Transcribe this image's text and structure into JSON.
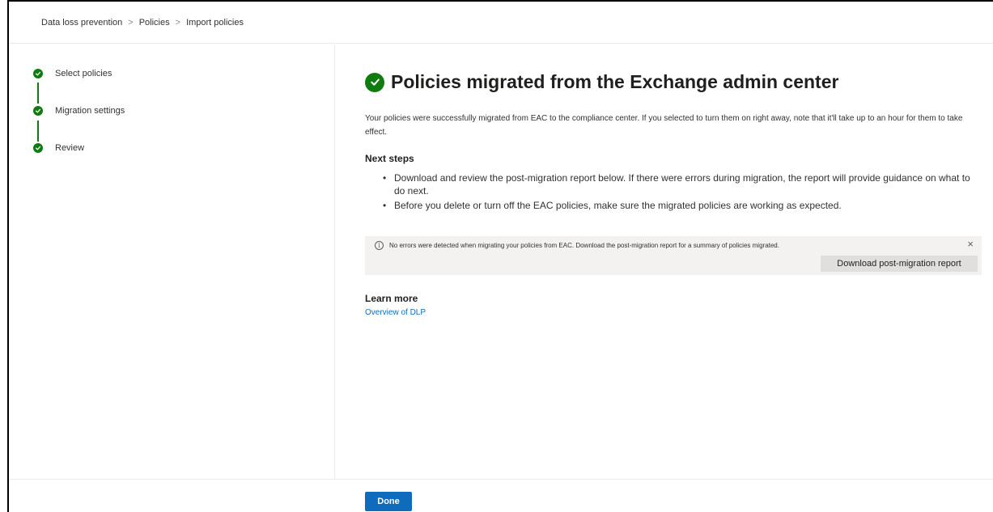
{
  "breadcrumb": {
    "items": [
      "Data loss prevention",
      "Policies",
      "Import policies"
    ],
    "separator": ">"
  },
  "steps": [
    {
      "label": "Select policies",
      "status": "complete"
    },
    {
      "label": "Migration settings",
      "status": "complete"
    },
    {
      "label": "Review",
      "status": "complete"
    }
  ],
  "main": {
    "title": "Policies migrated from the Exchange admin center",
    "intro": "Your policies were successfully migrated from EAC to the compliance center. If you selected to turn them on right away, note that it'll take up to an hour for them to take effect.",
    "next_steps_heading": "Next steps",
    "next_steps": [
      "Download and review the post-migration report below. If there were errors during migration, the report will provide guidance on what to do next.",
      "Before you delete or turn off the EAC policies, make sure the migrated policies are working as expected."
    ],
    "message_bar": {
      "text": "No errors were detected when migrating your policies from EAC. Download the post-migration report for a summary of policies migrated.",
      "button_label": "Download post-migration report",
      "close_glyph": "×"
    },
    "learn_more_heading": "Learn more",
    "learn_more_link": "Overview of DLP"
  },
  "footer": {
    "done_label": "Done"
  },
  "colors": {
    "success": "#107c10",
    "primary": "#0f6cbd",
    "message_bg": "#f3f2f1"
  }
}
